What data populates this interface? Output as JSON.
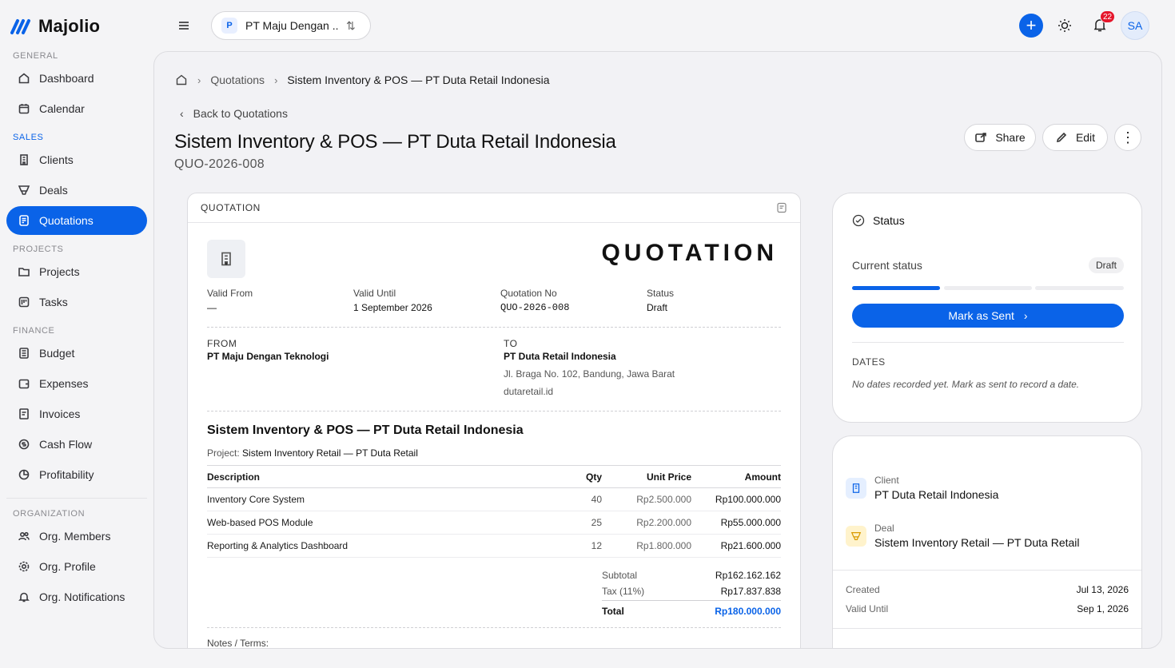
{
  "app": {
    "name": "Majolio",
    "accent": "#0a63e8"
  },
  "topbar": {
    "org_initial": "P",
    "org_name": "PT Maju Dengan ...",
    "notification_count": "22",
    "avatar_initials": "SA"
  },
  "sidebar": {
    "sections": {
      "general": "GENERAL",
      "sales": "SALES",
      "projects": "PROJECTS",
      "finance": "FINANCE",
      "organization": "ORGANIZATION"
    },
    "items": {
      "dashboard": "Dashboard",
      "calendar": "Calendar",
      "clients": "Clients",
      "deals": "Deals",
      "quotations": "Quotations",
      "projects": "Projects",
      "tasks": "Tasks",
      "budget": "Budget",
      "expenses": "Expenses",
      "invoices": "Invoices",
      "cash_flow": "Cash Flow",
      "profitability": "Profitability",
      "org_members": "Org. Members",
      "org_profile": "Org. Profile",
      "org_notifications": "Org. Notifications"
    }
  },
  "breadcrumb": {
    "parent": "Quotations",
    "current": "Sistem Inventory & POS — PT Duta Retail Indonesia"
  },
  "header": {
    "back_label": "Back to Quotations",
    "title": "Sistem Inventory & POS — PT Duta Retail Indonesia",
    "code": "QUO-2026-008",
    "share_label": "Share",
    "edit_label": "Edit"
  },
  "document": {
    "card_label": "QUOTATION",
    "big_title": "QUOTATION",
    "meta": [
      {
        "label": "Valid From",
        "value": "—"
      },
      {
        "label": "Valid Until",
        "value": "1 September 2026"
      },
      {
        "label": "Quotation No",
        "value": "QUO-2026-008"
      },
      {
        "label": "Status",
        "value": "Draft"
      }
    ],
    "from": {
      "label": "FROM",
      "name": "PT Maju Dengan Teknologi"
    },
    "to": {
      "label": "TO",
      "name": "PT Duta Retail Indonesia",
      "address": "Jl. Braga No. 102, Bandung, Jawa Barat",
      "website": "dutaretail.id"
    },
    "title": "Sistem Inventory & POS — PT Duta Retail Indonesia",
    "project_label": "Project:",
    "project_name": "Sistem Inventory Retail — PT Duta Retail",
    "columns": {
      "description": "Description",
      "qty": "Qty",
      "unit_price": "Unit Price",
      "amount": "Amount"
    },
    "rows": [
      {
        "description": "Inventory Core System",
        "qty": "40",
        "unit_price": "Rp2.500.000",
        "amount": "Rp100.000.000"
      },
      {
        "description": "Web-based POS Module",
        "qty": "25",
        "unit_price": "Rp2.200.000",
        "amount": "Rp55.000.000"
      },
      {
        "description": "Reporting & Analytics Dashboard",
        "qty": "12",
        "unit_price": "Rp1.800.000",
        "amount": "Rp21.600.000"
      }
    ],
    "subtotal_label": "Subtotal",
    "subtotal": "Rp162.162.162",
    "tax_label": "Tax (11%)",
    "tax": "Rp17.837.838",
    "total_label": "Total",
    "total": "Rp180.000.000",
    "notes_label": "Notes / Terms:"
  },
  "status_card": {
    "title": "Status",
    "current_label": "Current status",
    "current_value": "Draft",
    "progress_steps_done": 1,
    "progress_steps_total": 3,
    "action_label": "Mark as Sent",
    "dates_label": "DATES",
    "dates_empty": "No dates recorded yet. Mark as sent to record a date."
  },
  "relations_card": {
    "client_label": "Client",
    "client_value": "PT Duta Retail Indonesia",
    "deal_label": "Deal",
    "deal_value": "Sistem Inventory Retail — PT Duta Retail",
    "created_label": "Created",
    "created_value": "Jul 13, 2026",
    "valid_until_label": "Valid Until",
    "valid_until_value": "Sep 1, 2026"
  }
}
